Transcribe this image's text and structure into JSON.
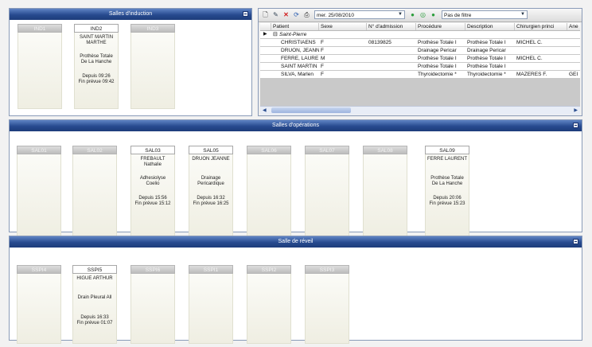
{
  "induction": {
    "title": "Salles d'induction",
    "slots": [
      {
        "name": "IND1",
        "active": false
      },
      {
        "name": "IND2",
        "active": true,
        "line1": "SAINT MARTIN",
        "line2": "MARTHE",
        "line3": "Prothèse Totale",
        "line4": "De La Hanche",
        "line5": "Depuis 09:26",
        "line6": "Fin prévue 09:42"
      },
      {
        "name": "IND3",
        "active": false
      }
    ]
  },
  "toolbar": {
    "date": "mer. 25/08/2010",
    "filter": "Pas de filtre"
  },
  "grid": {
    "columns": [
      "Patient",
      "Sexe",
      "N° d'admission",
      "Procédure",
      "Description",
      "Chirurgien princi",
      "Ane"
    ],
    "group": "Saint-Pierre",
    "rows": [
      {
        "patient": "CHRISTIAENS",
        "sexe": "F",
        "adm": "08139825",
        "proc": "Prothèse Totale I",
        "desc": "Prothèse Totale I",
        "chir": "MICHEL C.",
        "ane": ""
      },
      {
        "patient": "DRUON, JEANN",
        "sexe": "F",
        "adm": "",
        "proc": "Drainage Pericar",
        "desc": "Drainage Pericar",
        "chir": "",
        "ane": ""
      },
      {
        "patient": "FERRE, LAURE",
        "sexe": "M",
        "adm": "",
        "proc": "Prothèse Totale I",
        "desc": "Prothèse Totale I",
        "chir": "MICHEL C.",
        "ane": ""
      },
      {
        "patient": "SAINT MARTIN",
        "sexe": "F",
        "adm": "",
        "proc": "Prothèse Totale I",
        "desc": "Prothèse Totale I",
        "chir": "",
        "ane": ""
      },
      {
        "patient": "SILVA, Marlen",
        "sexe": "F",
        "adm": "",
        "proc": "Thyroidectomie *",
        "desc": "Thyroidectomie *",
        "chir": "MAZERES F.",
        "ane": "GEI"
      }
    ]
  },
  "operations": {
    "title": "Salles d'opérations",
    "slots": [
      {
        "name": "SAL01",
        "active": false
      },
      {
        "name": "SAL02",
        "active": false
      },
      {
        "name": "SAL03",
        "active": true,
        "line1": "FREBAULT",
        "line2": "Nathalie",
        "line3": "Adhesiolyse",
        "line4": "Coelio",
        "line5": "Depuis 15:56",
        "line6": "Fin prévue 15:12"
      },
      {
        "name": "SAL05",
        "active": true,
        "line1": "DRUON JEANNE",
        "line2": "",
        "line3": "Drainage",
        "line4": "Pericardique",
        "line5": "Depuis 16:32",
        "line6": "Fin prévue 16:25"
      },
      {
        "name": "SAL06",
        "active": false
      },
      {
        "name": "SAL07",
        "active": false
      },
      {
        "name": "SAL08",
        "active": false
      },
      {
        "name": "SAL09",
        "active": true,
        "line1": "FERRE LAURENT",
        "line2": "",
        "line3": "Prothèse Totale",
        "line4": "De La Hanche",
        "line5": "Depuis 20:06",
        "line6": "Fin prévue 15:23"
      }
    ]
  },
  "reveil": {
    "title": "Salle de réveil",
    "slots": [
      {
        "name": "SSPI4",
        "active": false
      },
      {
        "name": "SSPI5",
        "active": true,
        "line1": "HIGUE ARTHUR",
        "line2": "",
        "line3": "Drain Pleural All",
        "line4": "",
        "line5": "Depuis 16:33",
        "line6": "Fin prévue 01:07"
      },
      {
        "name": "SSPI6",
        "active": false
      },
      {
        "name": "SSPI1",
        "active": false
      },
      {
        "name": "SSPI2",
        "active": false
      },
      {
        "name": "SSPI3",
        "active": false
      }
    ]
  }
}
